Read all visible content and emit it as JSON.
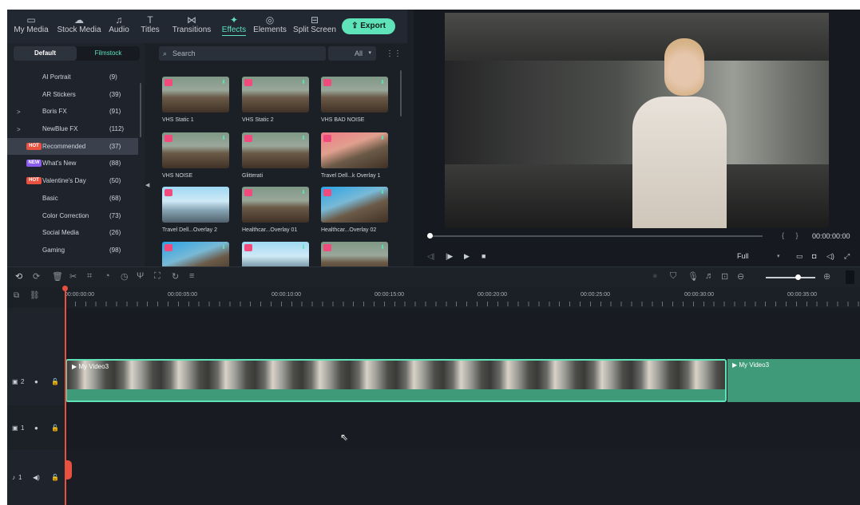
{
  "toolbar": {
    "items": [
      {
        "label": "My Media",
        "icon": "folder-icon"
      },
      {
        "label": "Stock Media",
        "icon": "cloud-icon"
      },
      {
        "label": "Audio",
        "icon": "music-note-icon"
      },
      {
        "label": "Titles",
        "icon": "text-icon"
      },
      {
        "label": "Transitions",
        "icon": "transitions-icon"
      },
      {
        "label": "Effects",
        "icon": "sparkle-icon",
        "active": true
      },
      {
        "label": "Elements",
        "icon": "elements-icon"
      },
      {
        "label": "Split Screen",
        "icon": "split-screen-icon"
      }
    ],
    "export_label": "Export"
  },
  "categories": {
    "tabs": [
      "Default",
      "Filmstock"
    ],
    "items": [
      {
        "name": "AI Portrait",
        "count": "(9)"
      },
      {
        "name": "AR Stickers",
        "count": "(39)"
      },
      {
        "name": "Boris FX",
        "count": "(91)",
        "expandable": true
      },
      {
        "name": "NewBlue FX",
        "count": "(112)",
        "expandable": true
      },
      {
        "name": "Recommended",
        "count": "(37)",
        "badge": "HOT",
        "selected": true
      },
      {
        "name": "What's New",
        "count": "(88)",
        "badge": "NEW"
      },
      {
        "name": "Valentine's Day",
        "count": "(50)",
        "badge": "HOT"
      },
      {
        "name": "Basic",
        "count": "(68)"
      },
      {
        "name": "Color Correction",
        "count": "(73)"
      },
      {
        "name": "Social Media",
        "count": "(26)"
      },
      {
        "name": "Gaming",
        "count": "(98)"
      }
    ]
  },
  "browser": {
    "search_placeholder": "Search",
    "filter_value": "All",
    "effects": [
      {
        "label": "VHS Static 1",
        "style": "normal"
      },
      {
        "label": "VHS Static 2",
        "style": "normal"
      },
      {
        "label": "VHS BAD NOISE",
        "style": "normal"
      },
      {
        "label": "VHS NOISE",
        "style": "normal"
      },
      {
        "label": "Glitterati",
        "style": "normal"
      },
      {
        "label": "Travel Dell...k Overlay 1",
        "style": "pink"
      },
      {
        "label": "Travel Dell...Overlay 2",
        "style": "sky"
      },
      {
        "label": "Healthcar...Overlay 01",
        "style": "normal"
      },
      {
        "label": "Healthcar...Overlay 02",
        "style": "blue"
      },
      {
        "label": "",
        "style": "blue"
      },
      {
        "label": "",
        "style": "sky"
      },
      {
        "label": "",
        "style": "normal"
      }
    ]
  },
  "player": {
    "timecode": "00:00:00:00",
    "bracket_in": "{",
    "bracket_out": "}",
    "quality": "Full"
  },
  "timeline": {
    "ruler_labels": [
      "00:00:00:00",
      "00:00:05:00",
      "00:00:10:00",
      "00:00:15:00",
      "00:00:20:00",
      "00:00:25:00",
      "00:00:30:00",
      "00:00:35:00"
    ],
    "tracks": [
      {
        "id": "video-2",
        "label": "2",
        "clip": "My Video3",
        "next_clip": "My Video3"
      },
      {
        "id": "video-1",
        "label": "1"
      },
      {
        "id": "audio-1",
        "label": "1"
      }
    ]
  }
}
